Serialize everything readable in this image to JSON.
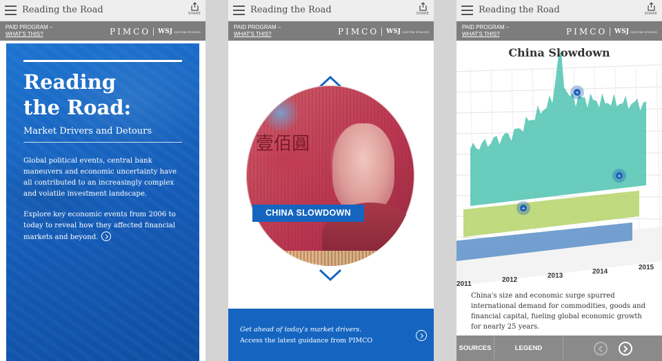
{
  "app": {
    "title": "Reading the Road",
    "share_label": "SHARE",
    "paid_label": "PAID PROGRAM –",
    "whats_this": "WHAT'S THIS?",
    "brand": "PIMCO",
    "wsj": "WSJ",
    "wsj_custom": "CUSTOM STUDIOS"
  },
  "intro": {
    "title_line1": "Reading",
    "title_line2": "the Road:",
    "subtitle": "Market Drivers and Detours",
    "paragraph1": "Global political events, central bank maneuvers and economic uncertainty have all contributed to an increasingly complex and volatile investment landscape.",
    "paragraph2": "Explore key economic events from 2006 to today to reveal how they affected financial markets and beyond."
  },
  "carousel": {
    "glyph": "壹佰圓",
    "banner": "CHINA SLOWDOWN",
    "cta_line1": "Get ahead of today's market drivers.",
    "cta_line2": "Access the latest guidance from PIMCO"
  },
  "chart_screen": {
    "caption": "China's size and economic surge spurred international demand for commodities, goods and financial capital, fueling global economic growth for nearly 25 years.",
    "sources": "SOURCES",
    "legend": "LEGEND"
  },
  "chart_data": {
    "type": "area",
    "title": "China Slowdown",
    "x": [
      "2011",
      "2012",
      "2013",
      "2014",
      "2015"
    ],
    "series": [
      {
        "color": "#4fc3b0",
        "values": [
          0.35,
          0.45,
          0.72,
          0.65,
          0.6
        ]
      },
      {
        "color": "#b5d36a",
        "values": [
          0.25,
          0.27,
          0.3,
          0.32,
          0.34
        ]
      },
      {
        "color": "#5b8fc9",
        "values": [
          0.12,
          0.14,
          0.16,
          0.18,
          0.2
        ]
      }
    ],
    "colors": {
      "accent": "#1565c0",
      "bar": "#7d7d7d"
    }
  }
}
